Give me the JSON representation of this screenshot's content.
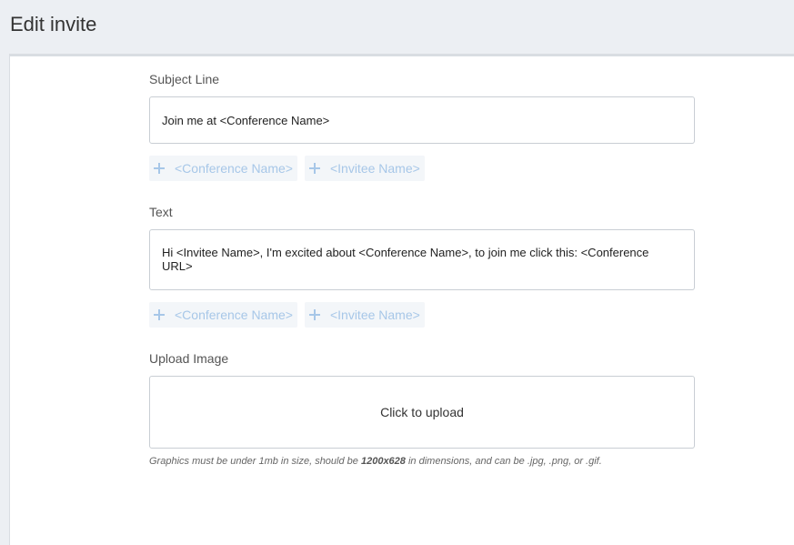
{
  "header": {
    "title": "Edit invite"
  },
  "subject": {
    "label": "Subject Line",
    "value": "Join me at <Conference Name>",
    "tokens": [
      "<Conference Name>",
      "<Invitee Name>"
    ]
  },
  "text": {
    "label": "Text",
    "value": "Hi <Invitee Name>, I'm excited about <Conference Name>, to join me click this: <Conference URL>",
    "tokens": [
      "<Conference Name>",
      "<Invitee Name>"
    ]
  },
  "upload": {
    "label": "Upload Image",
    "button_label": "Click to upload",
    "hint_prefix": "Graphics must be under 1mb in size, should be ",
    "hint_dimensions": "1200x628",
    "hint_suffix": " in dimensions, and can be .jpg, .png, or .gif."
  },
  "colors": {
    "token_text": "#a7c7e8",
    "token_bg": "#f3f6f9",
    "page_bg": "#eceff3"
  }
}
